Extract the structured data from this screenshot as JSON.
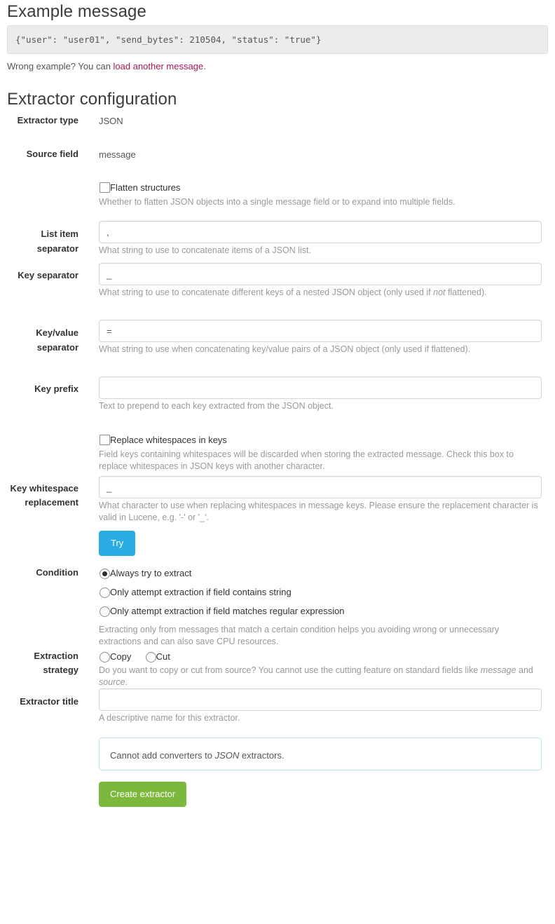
{
  "example": {
    "heading": "Example message",
    "message": "{\"user\": \"user01\", \"send_bytes\": 210504, \"status\": \"true\"}",
    "wrong_prefix": "Wrong example? You can ",
    "wrong_link": "load another message",
    "wrong_suffix": ".",
    "link_color": "#ad1457"
  },
  "config": {
    "heading": "Extractor configuration",
    "extractor_type_label": "Extractor type",
    "extractor_type_value": "JSON",
    "source_field_label": "Source field",
    "source_field_value": "message",
    "flatten": {
      "label": "Flatten structures",
      "checked": false,
      "help": "Whether to flatten JSON objects into a single message field or to expand into multiple fields."
    },
    "list_item_separator": {
      "label": "List item separator",
      "value": ",",
      "placeholder": "",
      "help": "What string to use to concatenate items of a JSON list."
    },
    "key_separator": {
      "label": "Key separator",
      "value": "_",
      "placeholder": "",
      "help_part1": "What string to use to concatenate different keys of a nested JSON object (only used if ",
      "help_em": "not",
      "help_part2": " flattened)."
    },
    "key_value_separator": {
      "label": "Key/value separator",
      "value": "=",
      "placeholder": "",
      "help": "What string to use when concatenating key/value pairs of a JSON object (only used if flattened)."
    },
    "key_prefix": {
      "label": "Key prefix",
      "value": "",
      "placeholder": "",
      "help": "Text to prepend to each key extracted from the JSON object."
    },
    "replace_whitespaces": {
      "label": "Replace whitespaces in keys",
      "checked": false,
      "help": "Field keys containing whitespaces will be discarded when storing the extracted message. Check this box to replace whitespaces in JSON keys with another character."
    },
    "key_whitespace_replacement": {
      "label": "Key whitespace replacement",
      "value": "_",
      "placeholder": "",
      "help": "What character to use when replacing whitespaces in message keys. Please ensure the replacement character is valid in Lucene, e.g. '-' or '_'."
    },
    "try_button": "Try",
    "try_button_color": "#2aabe2"
  },
  "condition": {
    "label": "Condition",
    "options": [
      {
        "label": "Always try to extract",
        "checked": true
      },
      {
        "label": "Only attempt extraction if field contains string",
        "checked": false
      },
      {
        "label": "Only attempt extraction if field matches regular expression",
        "checked": false
      }
    ],
    "help": "Extracting only from messages that match a certain condition helps you avoiding wrong or unnecessary extractions and can also save CPU resources."
  },
  "strategy": {
    "label": "Extraction strategy",
    "options": [
      {
        "label": "Copy",
        "checked": true
      },
      {
        "label": "Cut",
        "checked": false
      }
    ],
    "help_part1": "Do you want to copy or cut from source? You cannot use the cutting feature on standard fields like ",
    "help_em1": "message",
    "help_part2": " and ",
    "help_em2": "source",
    "help_part3": "."
  },
  "title_field": {
    "label": "Extractor title",
    "value": "",
    "placeholder": "",
    "help": "A descriptive name for this extractor."
  },
  "converters_alert": {
    "part1": "Cannot add converters to ",
    "em": "JSON",
    "part2": " extractors.",
    "border_color": "#bce8f1"
  },
  "submit": {
    "label": "Create extractor",
    "color": "#7cb83c"
  }
}
